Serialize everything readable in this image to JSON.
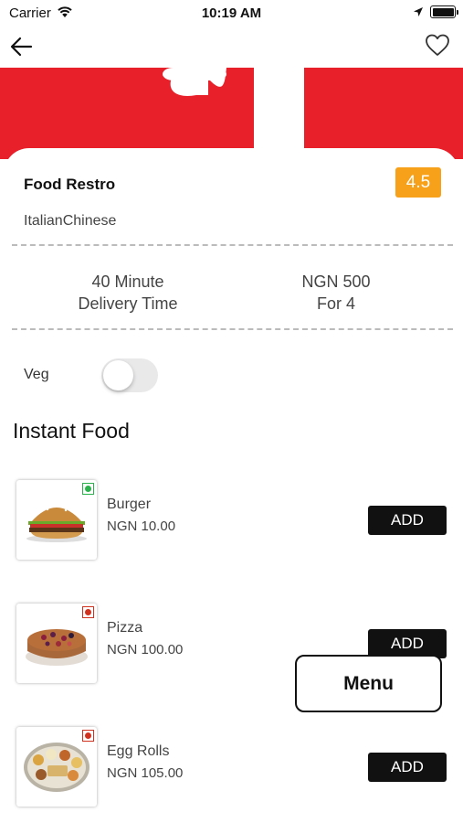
{
  "status_bar": {
    "carrier": "Carrier",
    "time": "10:19 AM"
  },
  "restaurant": {
    "name": "Food Restro",
    "rating": "4.5",
    "cuisines": "ItalianChinese"
  },
  "info": {
    "delivery_value": "40 Minute",
    "delivery_label": "Delivery Time",
    "cost_value": "NGN 500",
    "cost_label": "For 4"
  },
  "filter": {
    "veg_label": "Veg",
    "veg_on": false
  },
  "section": {
    "title": "Instant Food"
  },
  "items": [
    {
      "name": "Burger",
      "price": "NGN 10.00",
      "add_label": "ADD",
      "diet": "veg"
    },
    {
      "name": "Pizza",
      "price": "NGN 100.00",
      "add_label": "ADD",
      "diet": "non-veg"
    },
    {
      "name": "Egg Rolls",
      "price": "NGN 105.00",
      "add_label": "ADD",
      "diet": "non-veg"
    }
  ],
  "menu_button": {
    "label": "Menu"
  },
  "colors": {
    "hero_red": "#e8202a",
    "rating_bg": "#f7a01a",
    "veg_green": "#2bb24c",
    "nonveg_red": "#d0321f"
  },
  "icons": {
    "back": "arrow-left-icon",
    "favorite": "heart-outline-icon",
    "wifi": "wifi-icon",
    "location": "location-arrow-icon",
    "battery": "battery-icon"
  }
}
